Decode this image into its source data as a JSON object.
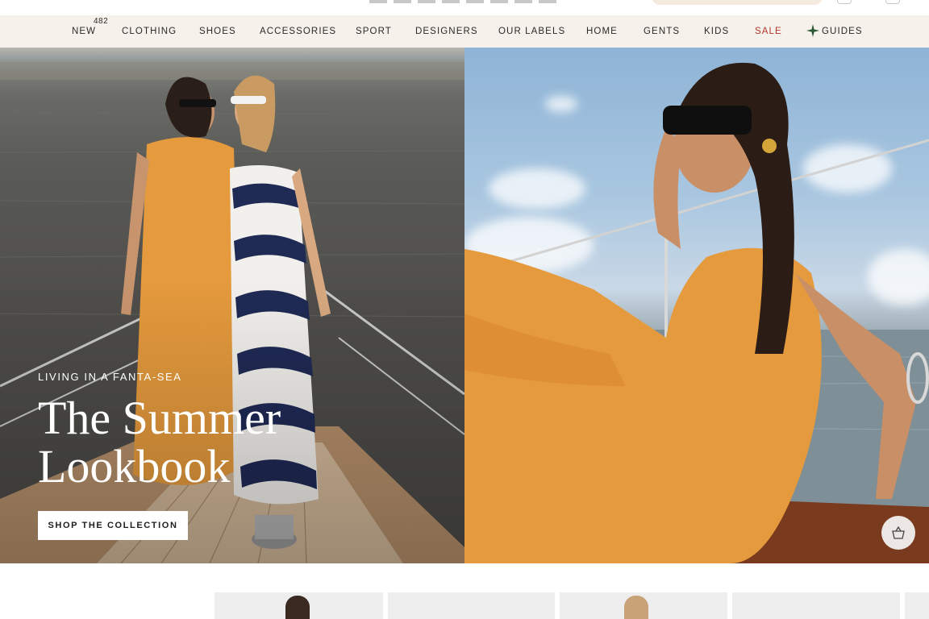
{
  "nav": {
    "items": [
      {
        "label": "New",
        "badge": "482"
      },
      {
        "label": "Clothing"
      },
      {
        "label": "Shoes"
      },
      {
        "label": "Accessories"
      },
      {
        "label": "Sport"
      },
      {
        "label": "Designers"
      },
      {
        "label": "Our Labels"
      },
      {
        "label": "Home"
      },
      {
        "label": "Gents"
      },
      {
        "label": "Kids"
      },
      {
        "label": "Sale"
      },
      {
        "label": "Guides",
        "icon": "compass-star-icon"
      }
    ]
  },
  "hero": {
    "eyebrow": "LIVING IN A FANTA-SEA",
    "title": "The Summer Lookbook",
    "cta_label": "SHOP THE COLLECTION"
  },
  "floating": {
    "icon": "basket-icon"
  },
  "colors": {
    "nav_bg": "#f6f1ea",
    "sale": "#b3342b",
    "dress_orange": "#e59a3d",
    "cta_bg": "#ffffff"
  }
}
